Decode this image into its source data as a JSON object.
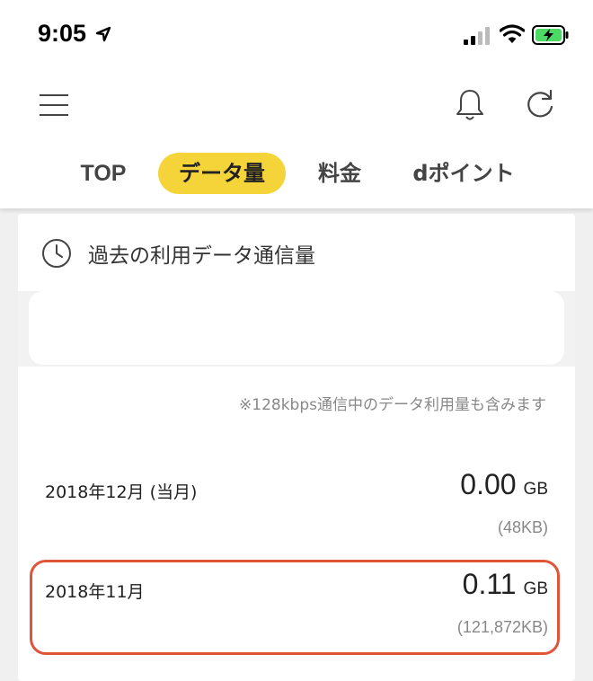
{
  "status_bar": {
    "time": "9:05",
    "icons": [
      "location-arrow-icon",
      "cellular-signal-icon",
      "wifi-icon",
      "battery-charging-icon"
    ]
  },
  "header": {
    "icons": [
      "menu-icon",
      "bell-icon",
      "refresh-icon"
    ],
    "tabs": [
      {
        "label": "TOP",
        "selected": false
      },
      {
        "label": "データ量",
        "selected": true
      },
      {
        "label": "料金",
        "selected": false
      },
      {
        "label": "dポイント",
        "selected": false
      }
    ]
  },
  "card": {
    "icon": "clock-icon",
    "title": "過去の利用データ通信量",
    "note": "※128kbps通信中のデータ利用量も含みます",
    "rows": [
      {
        "month": "2018年12月 (当月)",
        "value": "0.00",
        "unit": "GB",
        "kb": "(48KB)"
      },
      {
        "month": "2018年11月",
        "value": "0.11",
        "unit": "GB",
        "kb": "(121,872KB)"
      }
    ]
  },
  "colors": {
    "accent_tab": "#f5d43a",
    "highlight_border": "#e0553a",
    "battery_green": "#4cd964"
  }
}
